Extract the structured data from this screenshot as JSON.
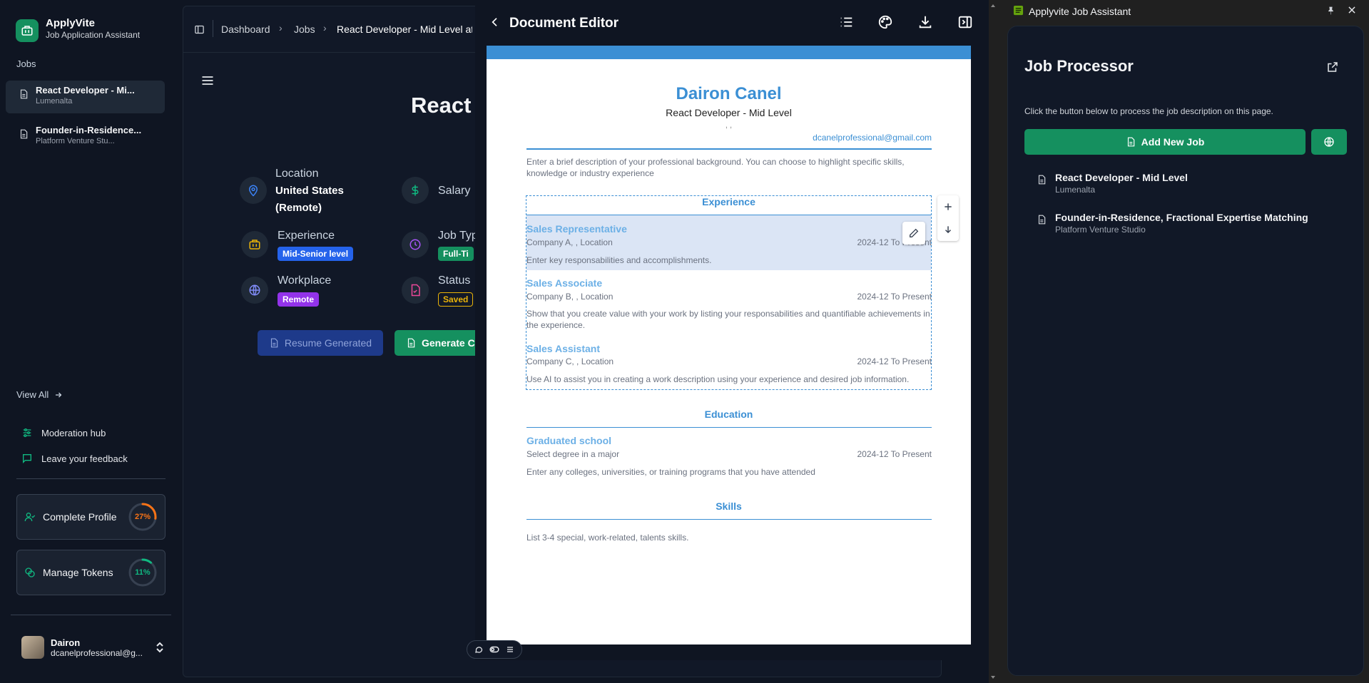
{
  "brand": {
    "name": "ApplyVite",
    "subtitle": "Job Application Assistant"
  },
  "sidebar": {
    "section_label": "Jobs",
    "jobs": [
      {
        "title": "React Developer - Mi...",
        "company": "Lumenalta"
      },
      {
        "title": "Founder-in-Residence...",
        "company": "Platform Venture Stu..."
      }
    ],
    "view_all": "View All",
    "links": [
      "Moderation hub",
      "Leave your feedback"
    ],
    "cards": [
      {
        "label": "Complete Profile",
        "percent_text": "27%",
        "percent": 27,
        "color": "#f97316"
      },
      {
        "label": "Manage Tokens",
        "percent_text": "11%",
        "percent": 11,
        "color": "#10b981"
      }
    ],
    "user": {
      "name": "Dairon",
      "email": "dcanelprofessional@g..."
    }
  },
  "breadcrumb": [
    "Dashboard",
    "Jobs",
    "React Developer - Mid Level at"
  ],
  "job": {
    "title_partial": "React D",
    "location_label": "Location",
    "location_value_1": "United States",
    "location_value_2": "(Remote)",
    "salary_label": "Salary",
    "experience_label": "Experience",
    "experience_badge": "Mid-Senior level",
    "jobtype_label": "Job Typ",
    "jobtype_badge": "Full-Ti",
    "workplace_label": "Workplace",
    "workplace_badge": "Remote",
    "status_label": "Status",
    "status_badge": "Saved",
    "btn_resume": "Resume Generated",
    "btn_generate": "Generate C"
  },
  "editor": {
    "title": "Document Editor",
    "doc": {
      "name": "Dairon Canel",
      "role": "React Developer - Mid Level",
      "commas": ", ,",
      "email": "dcanelprofessional@gmail.com",
      "summary_1": "Enter a brief description of your professional background. You can choose to highlight specific skills,",
      "summary_2": "knowledge or industry experience",
      "experience_heading": "Experience",
      "experience": [
        {
          "title": "Sales Representative",
          "company": "Company A, , Location",
          "date": "2024-12 To Present",
          "desc": "Enter key responsabilities and accomplishments."
        },
        {
          "title": "Sales Associate",
          "company": "Company B, , Location",
          "date": "2024-12 To Present",
          "desc": "Show that you create value with your work by listing your responsabilities and quantifiable achievements in the experience."
        },
        {
          "title": "Sales Assistant",
          "company": "Company C, , Location",
          "date": "2024-12 To Present",
          "desc": "Use AI to assist you in creating a work description using your experience and desired job information."
        }
      ],
      "education_heading": "Education",
      "education": {
        "title": "Graduated school",
        "degree": "Select degree in a major",
        "date": "2024-12 To Present",
        "desc": "Enter any colleges, universities, or training programs that you have attended"
      },
      "skills_heading": "Skills",
      "skills_desc": "List 3-4 special, work-related, talents skills."
    }
  },
  "assistant": {
    "window_title": "Applyvite Job Assistant",
    "title": "Job Processor",
    "description": "Click the button below to process the job description on this page.",
    "add_button": "Add New Job",
    "jobs": [
      {
        "title": "React Developer - Mid Level",
        "company": "Lumenalta"
      },
      {
        "title": "Founder-in-Residence, Fractional Expertise Matching",
        "company": "Platform Venture Studio"
      }
    ]
  },
  "colors": {
    "accent_green": "#15905f",
    "doc_blue": "#3b8fd4",
    "badge_blue": "#2563eb",
    "badge_purple": "#9333ea",
    "badge_saved": "#eab308"
  }
}
